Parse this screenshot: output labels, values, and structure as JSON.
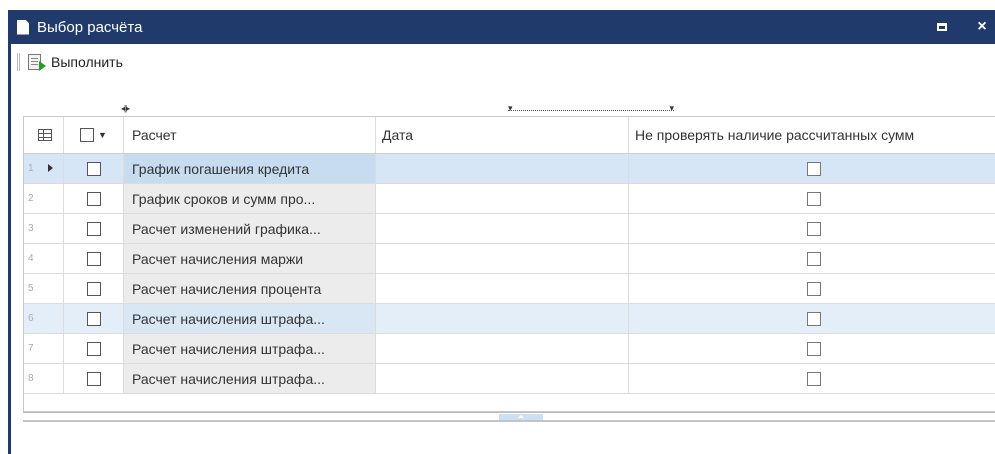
{
  "window": {
    "title": "Выбор расчёта",
    "maximize_glyph": "",
    "close_glyph": "×",
    "accent_color": "#1f3a6b"
  },
  "toolbar": {
    "run_label": "Выполнить"
  },
  "grid": {
    "columns": {
      "name": "Расчет",
      "date": "Дата",
      "flag": "Не проверять наличие рассчитанных сумм"
    },
    "rows": [
      {
        "num": "1",
        "name": "График погашения кредита",
        "date": "",
        "selected": true
      },
      {
        "num": "2",
        "name": "График сроков и сумм про...",
        "date": ""
      },
      {
        "num": "3",
        "name": "Расчет изменений графика...",
        "date": ""
      },
      {
        "num": "4",
        "name": "Расчет начисления маржи",
        "date": ""
      },
      {
        "num": "5",
        "name": "Расчет начисления процента",
        "date": ""
      },
      {
        "num": "6",
        "name": "Расчет начисления штрафа...",
        "date": ""
      },
      {
        "num": "7",
        "name": "Расчет начисления штрафа...",
        "date": ""
      },
      {
        "num": "8",
        "name": "Расчет начисления штрафа...",
        "date": ""
      }
    ]
  }
}
